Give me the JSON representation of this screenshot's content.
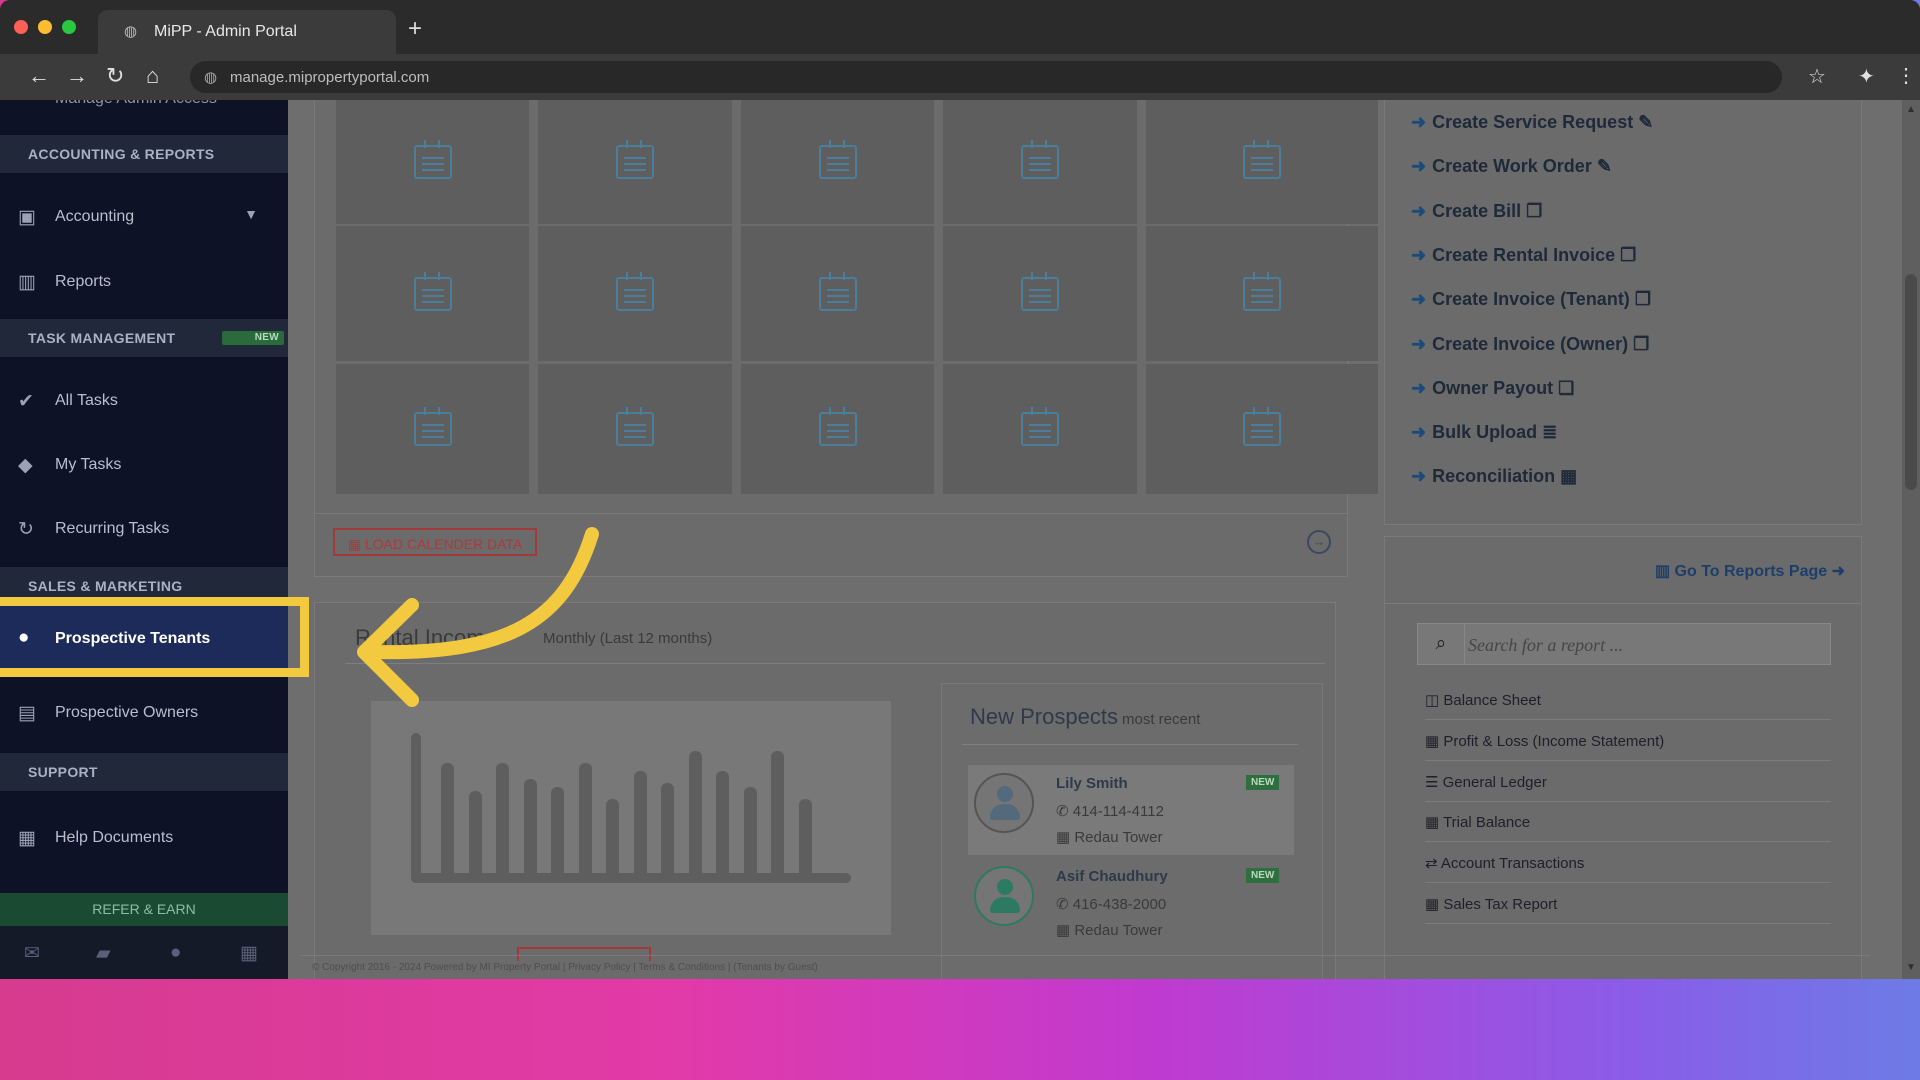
{
  "browser": {
    "tab_title": "MiPP - Admin Portal",
    "url": "manage.mipropertyportal.com"
  },
  "sidebar": {
    "partial_top_label": "Manage Admin Access",
    "sections": [
      {
        "header": "ACCOUNTING & REPORTS",
        "items": [
          {
            "label": "Accounting",
            "icon": "money-icon",
            "has_dropdown": true
          },
          {
            "label": "Reports",
            "icon": "bar-chart-icon"
          }
        ]
      },
      {
        "header": "TASK MANAGEMENT",
        "badge": "NEW",
        "items": [
          {
            "label": "All Tasks",
            "icon": "check-icon"
          },
          {
            "label": "My Tasks",
            "icon": "tag-icon"
          },
          {
            "label": "Recurring Tasks",
            "icon": "refresh-icon"
          }
        ]
      },
      {
        "header": "SALES & MARKETING",
        "items": [
          {
            "label": "Prospective Tenants",
            "icon": "users-icon",
            "highlighted": true
          },
          {
            "label": "Prospective Owners",
            "icon": "id-card-icon"
          }
        ]
      },
      {
        "header": "SUPPORT",
        "items": [
          {
            "label": "Help Documents",
            "icon": "book-icon"
          }
        ]
      }
    ],
    "refer_label": "REFER & EARN"
  },
  "calendar": {
    "load_button_label": "LOAD CALENDER DATA"
  },
  "income": {
    "title": "Rental Income",
    "subtitle": "Monthly (Last 12 months)"
  },
  "prospects": {
    "title": "New Prospects",
    "subtitle": "most recent",
    "items": [
      {
        "name": "Lily Smith",
        "phone": "414-114-4112",
        "building": "Redau Tower",
        "badge": "NEW"
      },
      {
        "name": "Asif Chaudhury",
        "phone": "416-438-2000",
        "building": "Redau Tower",
        "badge": "NEW"
      }
    ]
  },
  "actions": [
    {
      "label": "Create Service Request",
      "icon": "wrench-icon"
    },
    {
      "label": "Create Work Order",
      "icon": "wrench-icon"
    },
    {
      "label": "Create Bill",
      "icon": "copy-icon"
    },
    {
      "label": "Create Rental Invoice",
      "icon": "copy-icon"
    },
    {
      "label": "Create Invoice (Tenant)",
      "icon": "copy-icon"
    },
    {
      "label": "Create Invoice (Owner)",
      "icon": "copy-icon"
    },
    {
      "label": "Owner Payout",
      "icon": "clone-icon"
    },
    {
      "label": "Bulk Upload",
      "icon": "database-icon"
    },
    {
      "label": "Reconciliation",
      "icon": "calculator-icon"
    }
  ],
  "reports": {
    "link_label": "Go To Reports Page",
    "search_placeholder": "Search for a report ...",
    "items": [
      {
        "label": "Balance Sheet",
        "icon": "columns-icon"
      },
      {
        "label": "Profit & Loss (Income Statement)",
        "icon": "calculator-icon"
      },
      {
        "label": "General Ledger",
        "icon": "list-icon"
      },
      {
        "label": "Trial Balance",
        "icon": "calendar-icon"
      },
      {
        "label": "Account Transactions",
        "icon": "exchange-icon"
      },
      {
        "label": "Sales Tax Report",
        "icon": "calculator-icon"
      }
    ]
  },
  "footer": {
    "text": "© Copyright 2016 - 2024 Powered by MI Property Portal | Privacy Policy | Terms & Conditions | (Tenants by Guest)"
  },
  "annotation": {
    "color": "#f3c93f"
  }
}
